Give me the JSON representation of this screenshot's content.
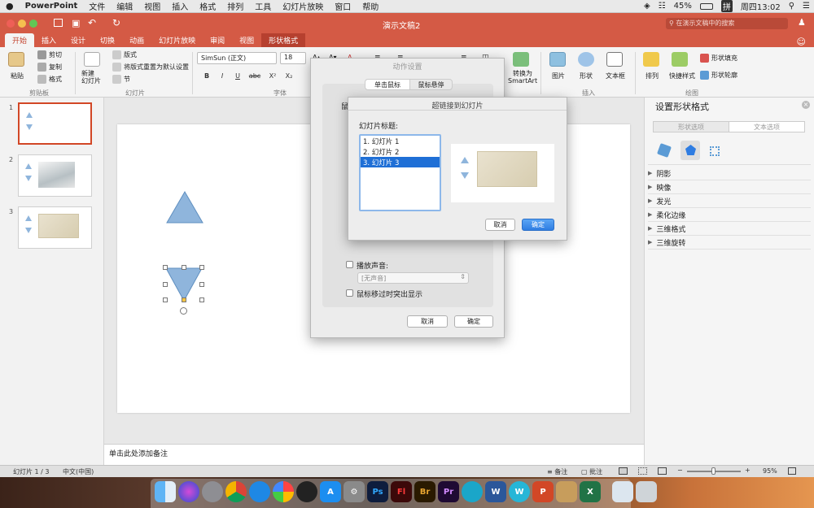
{
  "menubar": {
    "apple": "",
    "app_name": "PowerPoint",
    "items": [
      "文件",
      "编辑",
      "视图",
      "插入",
      "格式",
      "排列",
      "工具",
      "幻灯片放映",
      "窗口",
      "帮助"
    ],
    "battery": "45%",
    "input_method": "拼",
    "clock": "周四13:02"
  },
  "titlebar": {
    "doc_title": "演示文稿2",
    "search_placeholder": "在演示文稿中的搜索"
  },
  "ribbon_tabs": [
    "开始",
    "插入",
    "设计",
    "切换",
    "动画",
    "幻灯片放映",
    "审阅",
    "视图",
    "形状格式"
  ],
  "ribbon": {
    "paste": "粘贴",
    "cut": "剪切",
    "copy": "复制",
    "format": "格式",
    "clipboard_group": "剪贴板",
    "new_slide": "新建\n幻灯片",
    "layout": "版式",
    "reset": "将版式重置为默认设置",
    "section": "节",
    "slides_group": "幻灯片",
    "font_name": "SimSun (正文)",
    "font_size": "18",
    "font_group": "字体",
    "bold": "B",
    "italic": "I",
    "underline": "U",
    "strike": "abc",
    "superscript": "X²",
    "subscript": "X₂",
    "convert_smartart": "转换为\nSmartArt",
    "picture": "图片",
    "shape": "形状",
    "textbox": "文本框",
    "insert_group": "插入",
    "arrange": "排列",
    "quick_styles": "快捷样式",
    "shape_fill": "形状填充",
    "shape_outline": "形状轮廓",
    "drawing_group": "绘图"
  },
  "slides": [
    {
      "number": "1",
      "selected": true
    },
    {
      "number": "2",
      "selected": false
    },
    {
      "number": "3",
      "selected": false
    }
  ],
  "notes_placeholder": "单击此处添加备注",
  "format_pane": {
    "title": "设置形状格式",
    "tab_shape": "形状选项",
    "tab_text": "文本选项",
    "sections": [
      "阴影",
      "映像",
      "发光",
      "柔化边缘",
      "三维格式",
      "三维旋转"
    ]
  },
  "action_dialog": {
    "title": "动作设置",
    "tab_click": "单击鼠标",
    "tab_hover": "鼠标悬停",
    "partial_label": "鼠",
    "play_sound_label": "播放声音:",
    "sound_value": "[无声音]",
    "highlight_label": "鼠标移过时突出显示",
    "cancel": "取消",
    "ok": "确定"
  },
  "hyperlink_dialog": {
    "title": "超链接到幻灯片",
    "list_label": "幻灯片标题:",
    "items": [
      "1. 幻灯片 1",
      "2. 幻灯片 2",
      "3. 幻灯片 3"
    ],
    "selected_index": 2,
    "cancel": "取消",
    "ok": "确定"
  },
  "statusbar": {
    "slide_info": "幻灯片 1 / 3",
    "language": "中文(中国)",
    "notes": "备注",
    "comments": "批注",
    "zoom": "95%"
  },
  "dock": [
    "Ps",
    "Fl",
    "Br",
    "Pr",
    "W",
    "P",
    "X"
  ],
  "colors": {
    "ribbon_accent": "#d45a45",
    "shape_fill": "#8fb5dc",
    "primary_button": "#2f7de2"
  }
}
